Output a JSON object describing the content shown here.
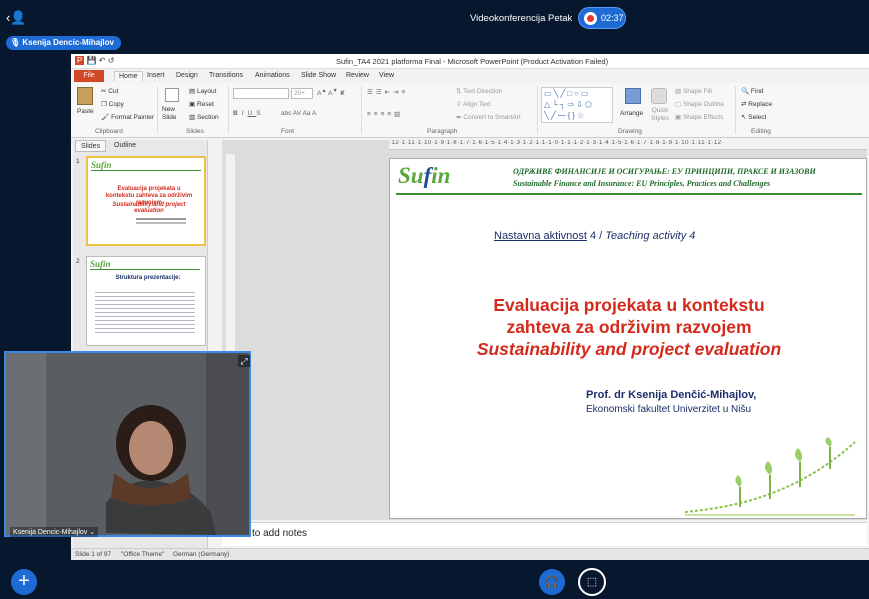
{
  "meeting": {
    "title": "Videokonferencija Petak",
    "recording_time": "02:37",
    "presenter_name": "Ksenija Dencic-Mihajlov"
  },
  "powerpoint": {
    "window_title": "Sufin_TA4 2021 platforma Final  -  Microsoft PowerPoint (Product Activation Failed)",
    "tabs": [
      "File",
      "Home",
      "Insert",
      "Design",
      "Transitions",
      "Animations",
      "Slide Show",
      "Review",
      "View"
    ],
    "ribbon": {
      "clipboard": {
        "label": "Clipboard",
        "paste": "Paste",
        "cut": "Cut",
        "copy": "Copy",
        "format_painter": "Format Painter"
      },
      "slides": {
        "label": "Slides",
        "new_slide": "New Slide",
        "layout": "Layout",
        "reset": "Reset",
        "section": "Section"
      },
      "font": {
        "label": "Font",
        "size": "20+"
      },
      "paragraph": {
        "label": "Paragraph",
        "text_direction": "Text Direction",
        "align_text": "Align Text",
        "convert_smartart": "Convert to SmartArt"
      },
      "drawing": {
        "label": "Drawing",
        "arrange": "Arrange",
        "quick_styles": "Quick Styles",
        "shape_fill": "Shape Fill",
        "shape_outline": "Shape Outline",
        "shape_effects": "Shape Effects"
      },
      "editing": {
        "label": "Editing",
        "find": "Find",
        "replace": "Replace",
        "select": "Select"
      }
    },
    "pane_tabs": [
      "Slides",
      "Outline"
    ],
    "thumbnails": [
      {
        "num": "1",
        "title": "Evaluacija projekata u kontekstu zahteva za održivim razvojem",
        "subtitle": "Sustainability and project evaluation"
      },
      {
        "num": "2",
        "title": "Struktura prezentacije:"
      }
    ],
    "ruler": "·12·1·11·1·10·1·9·1·8·1·7·1·6·1·5·1·4·1·3·1·2·1·1·1·0·1·1·1·2·1·3·1·4·1·5·1·6·1·7·1·8·1·9·1·10·1·11·1·12·",
    "notes_placeholder": "to add notes",
    "status": {
      "slide": "Slide 1 of 97",
      "theme": "\"Office Theme\"",
      "language": "German (Germany)"
    }
  },
  "slide": {
    "logo": {
      "part1": "Su",
      "part2": "f",
      "part3": "in"
    },
    "header_cyrillic": "ОДРЖИВЕ ФИНАНСИЈЕ И ОСИГУРАЊЕ: ЕУ ПРИНЦИПИ, ПРАКСЕ И ИЗАЗОВИ",
    "header_english": "Sustainable Finance and Insurance: EU Principles, Practices and Challenges",
    "teaching_prefix": "Nastavna aktivnost",
    "teaching_num": " 4 / ",
    "teaching_en": "Teaching activity 4",
    "title_line1": "Evaluacija projekata u kontekstu",
    "title_line2": "zahteva za održivim razvojem",
    "title_line3": "Sustainability and project evaluation",
    "author": "Prof. dr Ksenija Denčić-Mihajlov,",
    "faculty": "Ekonomski fakultet Univerzitet u Nišu"
  },
  "video": {
    "label": "Ksenija Dencic-Mihajlov"
  },
  "colors": {
    "accent": "#1e6bd6",
    "background": "#06172e",
    "title_red": "#d42a1c",
    "green": "#3a8e2f"
  }
}
